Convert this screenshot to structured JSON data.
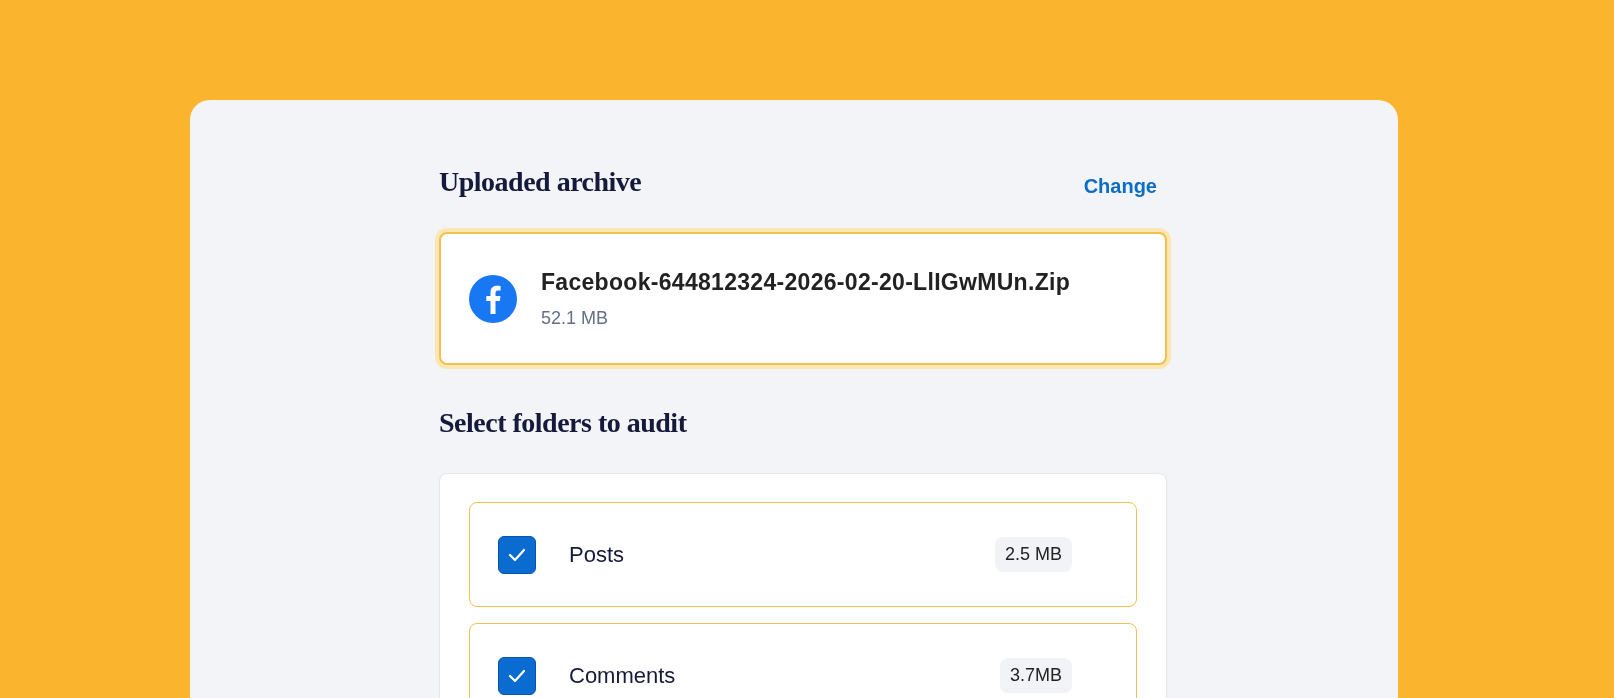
{
  "archive": {
    "heading": "Uploaded archive",
    "change_link": "Change",
    "file": {
      "name": "Facebook-644812324-2026-02-20-LlIGwMUn.Zip",
      "size": "52.1 MB"
    }
  },
  "folders": {
    "heading": "Select folders to audit",
    "items": [
      {
        "name": "Posts",
        "size": "2.5 MB",
        "checked": true
      },
      {
        "name": "Comments",
        "size": "3.7MB",
        "checked": true
      }
    ]
  }
}
